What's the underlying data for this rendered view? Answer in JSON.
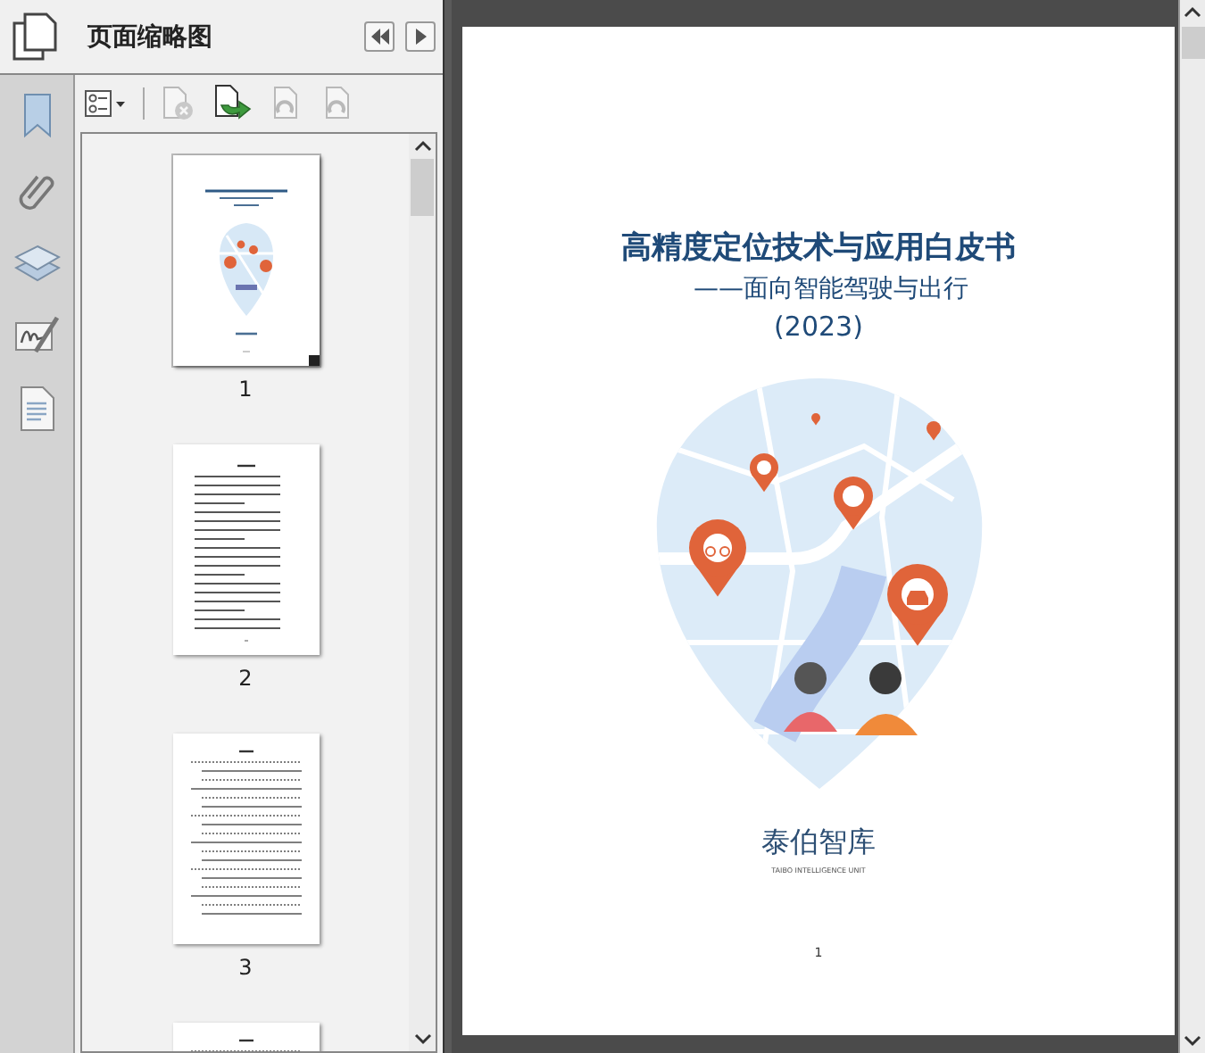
{
  "panel": {
    "title": "页面缩略图"
  },
  "toolbar": [
    {
      "kind": "options",
      "disabled": false
    },
    {
      "kind": "delete",
      "disabled": true
    },
    {
      "kind": "insert",
      "disabled": false
    },
    {
      "kind": "rotate-left",
      "disabled": true
    },
    {
      "kind": "rotate-right",
      "disabled": true
    }
  ],
  "thumbnails": [
    {
      "kind": "cover",
      "label": "1",
      "selected": true
    },
    {
      "kind": "list",
      "label": "2",
      "selected": false
    },
    {
      "kind": "toc",
      "label": "3",
      "selected": false
    },
    {
      "kind": "toc",
      "selected": false
    }
  ],
  "document": {
    "title": "高精度定位技术与应用白皮书",
    "subtitle": "——面向智能驾驶与出行",
    "year": "(2023)",
    "publisher": "泰伯智库",
    "publisher_en": "TAIBO INTELLIGENCE UNIT",
    "page_number": "1"
  }
}
